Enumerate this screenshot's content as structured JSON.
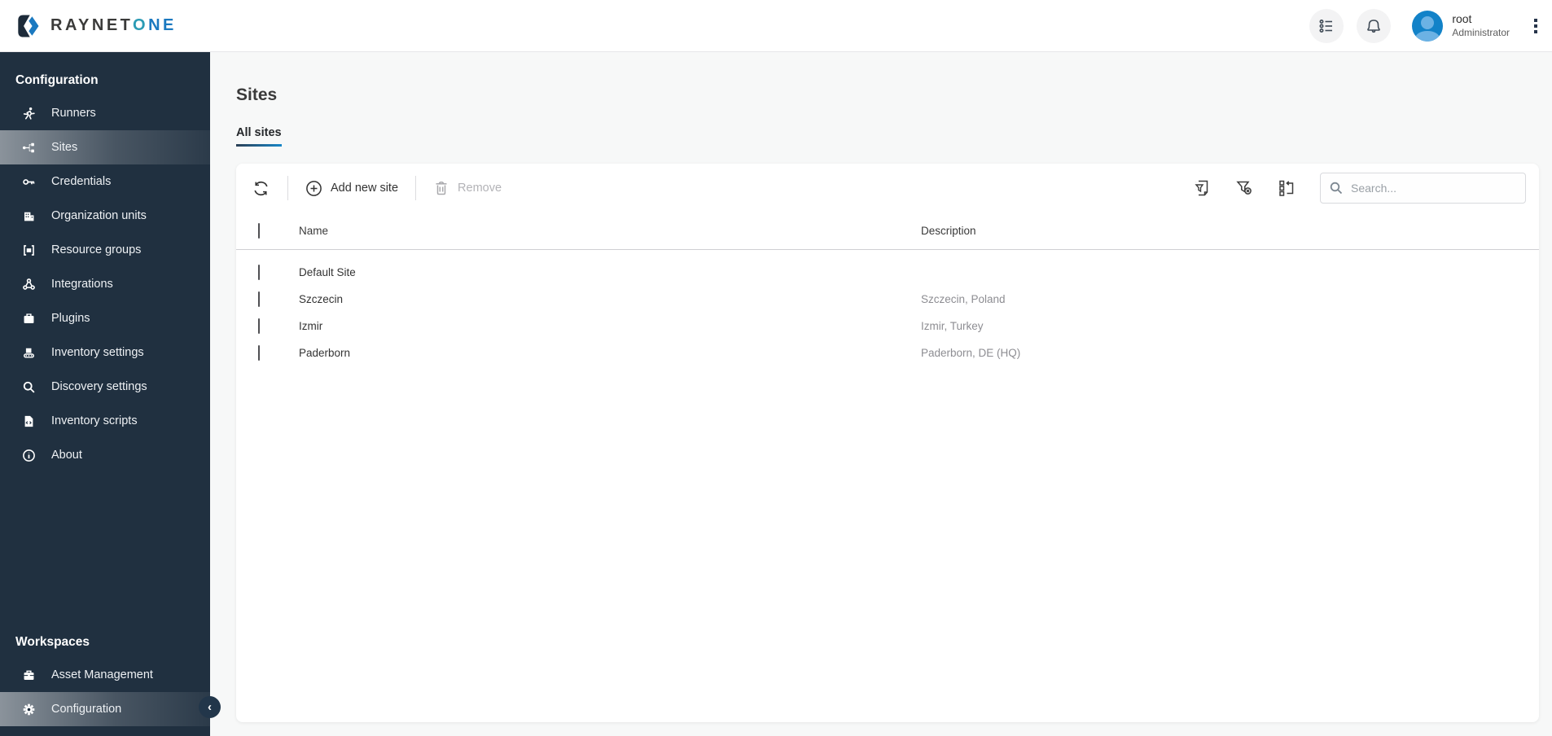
{
  "topbar": {
    "logo_primary": "RAYNET",
    "logo_o": "O",
    "logo_ne": "NE",
    "user": {
      "name": "root",
      "role": "Administrator"
    }
  },
  "sidebar": {
    "sections": [
      {
        "heading": "Configuration",
        "items": [
          {
            "label": "Runners",
            "icon": "runner",
            "active": false
          },
          {
            "label": "Sites",
            "icon": "sites",
            "active": true
          },
          {
            "label": "Credentials",
            "icon": "key",
            "active": false
          },
          {
            "label": "Organization units",
            "icon": "org",
            "active": false
          },
          {
            "label": "Resource groups",
            "icon": "resource",
            "active": false
          },
          {
            "label": "Integrations",
            "icon": "integrations",
            "active": false
          },
          {
            "label": "Plugins",
            "icon": "plugins",
            "active": false
          },
          {
            "label": "Inventory settings",
            "icon": "inventory",
            "active": false
          },
          {
            "label": "Discovery settings",
            "icon": "discovery",
            "active": false
          },
          {
            "label": "Inventory scripts",
            "icon": "scripts",
            "active": false
          },
          {
            "label": "About",
            "icon": "about",
            "active": false
          }
        ]
      },
      {
        "heading": "Workspaces",
        "items": [
          {
            "label": "Asset Management",
            "icon": "briefcase",
            "active": false
          },
          {
            "label": "Configuration",
            "icon": "gear",
            "active": true
          }
        ]
      }
    ]
  },
  "main": {
    "title": "Sites",
    "tabs": [
      {
        "label": "All sites",
        "active": true
      }
    ],
    "toolbar": {
      "refresh_icon": "refresh-icon",
      "add_label": "Add new site",
      "remove_label": "Remove",
      "right_icons": [
        "export-filter-icon",
        "clear-filter-icon",
        "choose-columns-icon"
      ],
      "search_placeholder": "Search..."
    },
    "table": {
      "columns": [
        "Name",
        "Description"
      ],
      "rows": [
        {
          "name": "Default Site",
          "description": ""
        },
        {
          "name": "Szczecin",
          "description": "Szczecin, Poland"
        },
        {
          "name": "Izmir",
          "description": "Izmir, Turkey"
        },
        {
          "name": "Paderborn",
          "description": "Paderborn, DE (HQ)"
        }
      ]
    }
  },
  "colors": {
    "sidebar_bg": "#203040",
    "accent_blue": "#1787c8",
    "logo_teal": "#2b9bb4",
    "logo_blue": "#1b79c0",
    "avatar_blue": "#1282c8",
    "disabled_text": "#b3b3b7",
    "description_text": "#8d8d92"
  }
}
